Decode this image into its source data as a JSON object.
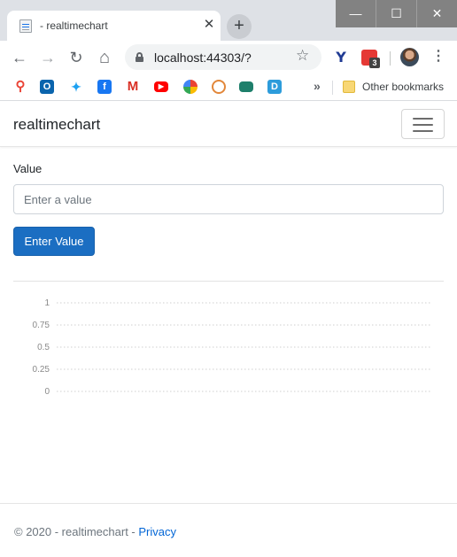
{
  "browser": {
    "tab_title": "- realtimechart",
    "tab_close": "✕",
    "new_tab": "+",
    "window_controls": {
      "minimize": "—",
      "maximize": "☐",
      "close": "✕"
    },
    "nav": {
      "back": "←",
      "forward": "→",
      "reload": "↻",
      "home": "⌂"
    },
    "url": "localhost:44303/?",
    "bookmark_star": "☆",
    "extensions": {
      "v_icon": "Y",
      "red_badge_count": "3"
    },
    "menu": "⋮",
    "bookmarks_bar": {
      "icons": [
        "maps-icon",
        "outlook-icon",
        "twitter-icon",
        "facebook-icon",
        "gmail-icon",
        "youtube-icon",
        "photos-icon",
        "swirl-icon",
        "gamepad-icon",
        "d-icon"
      ],
      "glyphs": {
        "maps": "⚲",
        "outlook": "O",
        "twitter": "✦",
        "facebook": "f",
        "gmail": "M",
        "youtube": "▶",
        "d": "D"
      },
      "more": "»",
      "other_bookmarks": "Other bookmarks"
    }
  },
  "page": {
    "brand": "realtimechart",
    "form": {
      "label": "Value",
      "placeholder": "Enter a value",
      "value": "",
      "button": "Enter Value"
    },
    "footer": {
      "copyright": "© 2020 - realtimechart - ",
      "privacy": "Privacy"
    }
  },
  "colors": {
    "primary_button": "#1b6ec2",
    "link": "#0366d6",
    "chrome_titlebar": "#dee1e6",
    "window_controls": "#828282"
  },
  "chart_data": {
    "type": "line",
    "title": "",
    "xlabel": "",
    "ylabel": "",
    "ylim": [
      0,
      1
    ],
    "y_ticks": [
      "1",
      "0.75",
      "0.5",
      "0.25",
      "0"
    ],
    "y_tick_values": [
      1,
      0.75,
      0.5,
      0.25,
      0
    ],
    "grid": true,
    "grid_style": "dotted",
    "series": []
  }
}
